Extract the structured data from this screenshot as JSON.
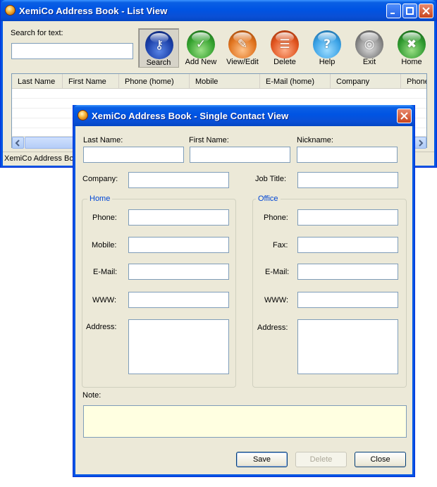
{
  "list_window": {
    "title": "XemiCo Address Book - List View",
    "search_label": "Search for text:",
    "search_value": "",
    "toolbar": [
      {
        "label": "Search",
        "icon": "search-icon",
        "color": "#1a3fa8"
      },
      {
        "label": "Add New",
        "icon": "add-new-icon",
        "color": "#33a12d"
      },
      {
        "label": "View/Edit",
        "icon": "view-edit-icon",
        "color": "#e0731e"
      },
      {
        "label": "Delete",
        "icon": "delete-icon",
        "color": "#e0531e"
      },
      {
        "label": "Help",
        "icon": "help-icon",
        "color": "#3aa2e6"
      },
      {
        "label": "Exit",
        "icon": "exit-icon",
        "color": "#8a8a8a"
      },
      {
        "label": "Home",
        "icon": "home-icon",
        "color": "#2f9a2f"
      }
    ],
    "columns": [
      "Last Name",
      "First Name",
      "Phone (home)",
      "Mobile",
      "E-Mail (home)",
      "Company",
      "Phone"
    ],
    "status_text": "XemiCo Address Book"
  },
  "contact_dialog": {
    "title": "XemiCo Address Book - Single Contact View",
    "last_name_label": "Last Name:",
    "first_name_label": "First Name:",
    "nickname_label": "Nickname:",
    "company_label": "Company:",
    "job_title_label": "Job Title:",
    "home": {
      "legend": "Home",
      "phone_label": "Phone:",
      "mobile_label": "Mobile:",
      "email_label": "E-Mail:",
      "www_label": "WWW:",
      "address_label": "Address:"
    },
    "office": {
      "legend": "Office",
      "phone_label": "Phone:",
      "fax_label": "Fax:",
      "email_label": "E-Mail:",
      "www_label": "WWW:",
      "address_label": "Address:"
    },
    "note_label": "Note:",
    "buttons": {
      "save": "Save",
      "delete": "Delete",
      "close": "Close"
    }
  },
  "colors": {
    "titlebar": "#0054e3",
    "window_bg": "#ece9d8",
    "note_bg": "#ffffe1",
    "group_legend": "#0046d5"
  }
}
